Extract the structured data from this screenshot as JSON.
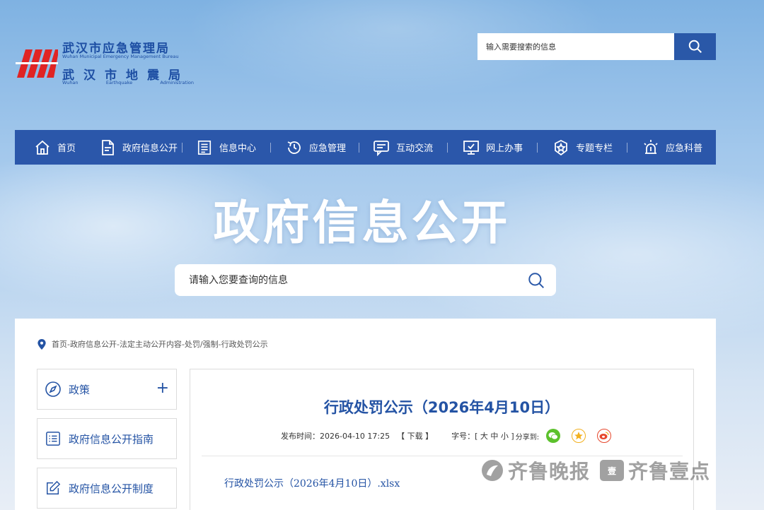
{
  "header": {
    "logo": {
      "cn_line1": "武汉市应急管理局",
      "en_line1": "Wuhan Municipal Emergency Management Bureau",
      "cn_line2": "武汉市地震局",
      "en_line2": [
        "Wuhan",
        "Earthquake",
        "Administration"
      ]
    },
    "search": {
      "placeholder": "输入需要搜索的信息",
      "button_icon": "search-icon"
    }
  },
  "nav": {
    "items": [
      {
        "label": "首页",
        "icon": "home-icon"
      },
      {
        "label": "政府信息公开",
        "icon": "document-icon"
      },
      {
        "label": "信息中心",
        "icon": "news-icon"
      },
      {
        "label": "应急管理",
        "icon": "clock-arrow-icon"
      },
      {
        "label": "互动交流",
        "icon": "chat-icon"
      },
      {
        "label": "网上办事",
        "icon": "monitor-icon"
      },
      {
        "label": "专题专栏",
        "icon": "star-badge-icon"
      },
      {
        "label": "应急科普",
        "icon": "alarm-light-icon"
      }
    ]
  },
  "banner": {
    "title": "政府信息公开",
    "search_placeholder": "请输入您要查询的信息"
  },
  "breadcrumb": "首页-政府信息公开-法定主动公开内容-处罚/强制-行政处罚公示",
  "sidebar": {
    "items": [
      {
        "label": "政策",
        "icon": "compass-icon",
        "has_plus": true
      },
      {
        "label": "政府信息公开指南",
        "icon": "list-icon"
      },
      {
        "label": "政府信息公开制度",
        "icon": "edit-icon"
      }
    ]
  },
  "article": {
    "title": "行政处罚公示（2026年4月10日）",
    "publish_label": "发布时间：",
    "publish_time": "2026-04-10 17:25",
    "download_label": "【 下载 】",
    "font_label": "字号：",
    "font_options": "[ 大 中 小 ]",
    "share_label": "分享到:",
    "share_icons": [
      "wechat-icon",
      "qzone-icon",
      "weibo-icon"
    ],
    "attachment": "行政处罚公示（2026年4月10日）.xlsx"
  },
  "watermark": {
    "text1": "齐鲁晚报",
    "badge": "壹",
    "text2": "齐鲁壹点"
  },
  "colors": {
    "primary": "#2b57aa",
    "link": "#2453a4",
    "wechat": "#5cc12c",
    "qzone": "#f2b01e",
    "weibo": "#e6472c"
  }
}
